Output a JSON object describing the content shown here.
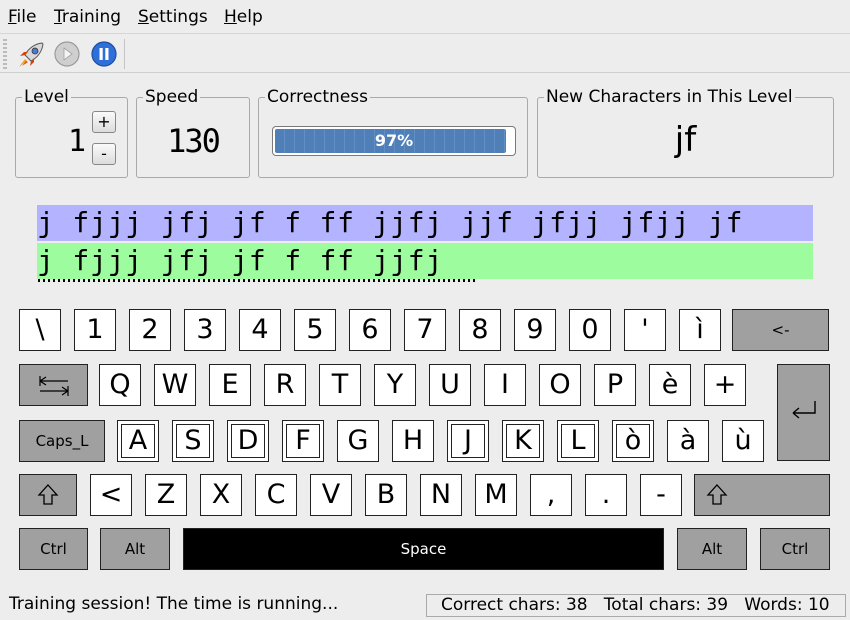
{
  "menu": {
    "file": {
      "mnemonic": "F",
      "rest": "ile"
    },
    "training": {
      "mnemonic": "T",
      "rest": "raining"
    },
    "settings": {
      "mnemonic": "S",
      "rest": "ettings"
    },
    "help": {
      "mnemonic": "H",
      "rest": "elp"
    }
  },
  "toolbar": {
    "icons": [
      "rocket-icon",
      "play-icon",
      "pause-icon"
    ]
  },
  "level": {
    "title": "Level",
    "value": "1",
    "increase": "+",
    "decrease": "-"
  },
  "speed": {
    "title": "Speed",
    "value": "130"
  },
  "correctness": {
    "title": "Correctness",
    "percent_label": "97%",
    "percent": 97,
    "fill_color": "#4f7fb6"
  },
  "new_chars": {
    "title": "New Characters in This Level",
    "value": "jf"
  },
  "lines": {
    "target": "j fjjj jfj jf f ff jjfj jjf jfjj jfjj jf",
    "typed": "j fjjj jfj jf f ff jjfj",
    "target_bg": "#b3b3ff",
    "typed_bg": "#9dfc9d"
  },
  "keyboard": {
    "row1": [
      "\\",
      "1",
      "2",
      "3",
      "4",
      "5",
      "6",
      "7",
      "8",
      "9",
      "0",
      "'",
      "ì"
    ],
    "backspace": "<-",
    "row2": [
      "Q",
      "W",
      "E",
      "R",
      "T",
      "Y",
      "U",
      "I",
      "O",
      "P",
      "è",
      "+"
    ],
    "caps": "Caps_L",
    "row3": [
      "A",
      "S",
      "D",
      "F",
      "G",
      "H",
      "J",
      "K",
      "L",
      "ò",
      "à",
      "ù"
    ],
    "row4": [
      "<",
      "Z",
      "X",
      "C",
      "V",
      "B",
      "N",
      "M",
      ",",
      ".",
      "-"
    ],
    "ctrl_left": "Ctrl",
    "alt_left": "Alt",
    "space": "Space",
    "alt_right": "Alt",
    "ctrl_right": "Ctrl",
    "highlight_color": "#a0a0a0"
  },
  "status": {
    "message": "Training session! The time is running...",
    "stats": "Correct chars: 38   Total chars: 39   Words: 10"
  }
}
